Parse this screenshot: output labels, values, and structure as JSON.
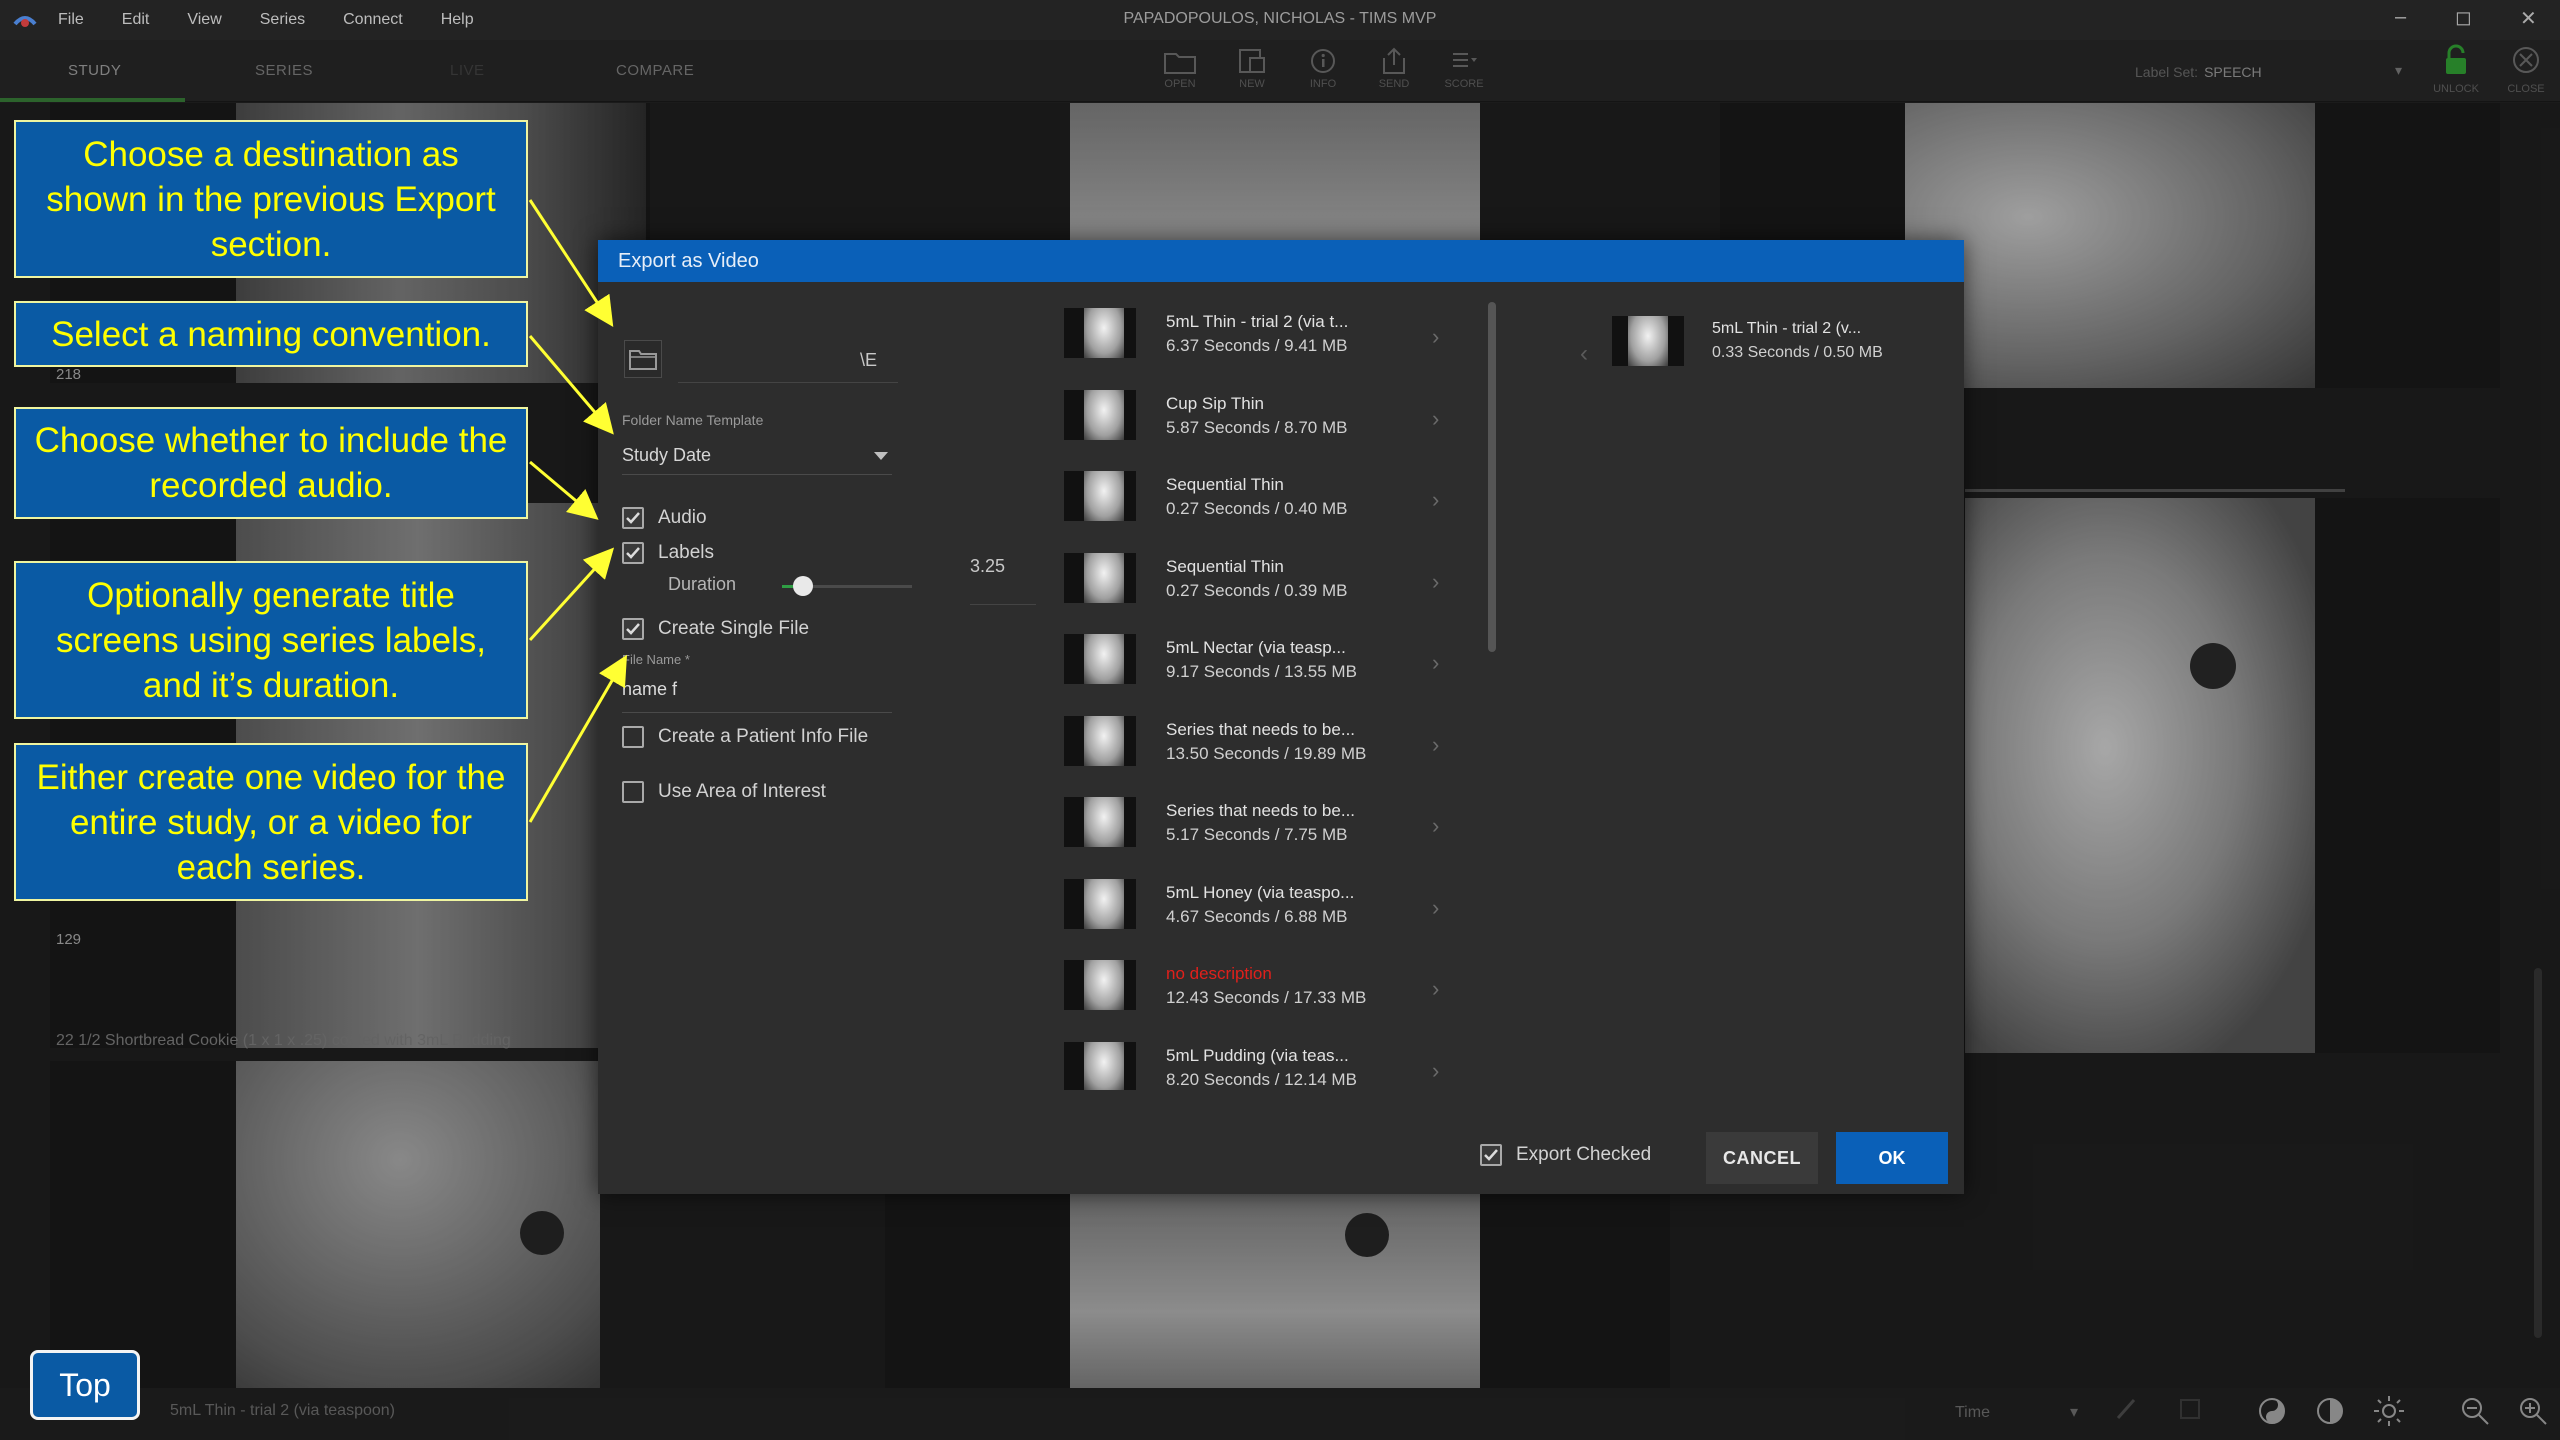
{
  "window": {
    "title": "PAPADOPOULOS, NICHOLAS - TIMS MVP",
    "menu": [
      "File",
      "Edit",
      "View",
      "Series",
      "Connect",
      "Help"
    ]
  },
  "tabs": [
    "STUDY",
    "SERIES",
    "LIVE",
    "COMPARE"
  ],
  "toolbar": {
    "tools": [
      "OPEN",
      "NEW",
      "INFO",
      "SEND",
      "SCORE"
    ],
    "label_set_prefix": "Label Set:",
    "label_set_value": "SPEECH",
    "unlock_label": "UNLOCK",
    "close_label": "CLOSE"
  },
  "workspace": {
    "frame_numbers": [
      "218",
      "129"
    ],
    "series_caption": "22  1/2 Shortbread Cookie (1 x 1 x .25) coated with 3mL Pudding"
  },
  "bottom": {
    "caption": "5mL Thin - trial 2 (via teaspoon)",
    "time_label": "Time"
  },
  "dialog": {
    "title": "Export as Video",
    "destination_path": "\\E",
    "folder_template_label": "Folder Name Template",
    "folder_template_value": "Study Date",
    "audio_label": "Audio",
    "audio_checked": true,
    "labels_label": "Labels",
    "labels_checked": true,
    "duration_label": "Duration",
    "duration_value": "3.25",
    "duration_fraction": 0.16,
    "single_file_label": "Create Single File",
    "single_file_checked": true,
    "file_name_label": "File Name *",
    "file_name_value": "name f",
    "patient_info_label": "Create a Patient Info File",
    "patient_info_checked": false,
    "area_of_interest_label": "Use Area of Interest",
    "area_of_interest_checked": false,
    "series": [
      {
        "title": "5mL Thin - trial 2 (via t...",
        "meta": "6.37 Seconds / 9.41 MB",
        "red": false
      },
      {
        "title": "Cup Sip Thin",
        "meta": "5.87 Seconds / 8.70 MB",
        "red": false
      },
      {
        "title": "Sequential Thin",
        "meta": "0.27 Seconds / 0.40 MB",
        "red": false
      },
      {
        "title": "Sequential Thin",
        "meta": "0.27 Seconds / 0.39 MB",
        "red": false
      },
      {
        "title": "5mL Nectar (via teasp...",
        "meta": "9.17 Seconds / 13.55 MB",
        "red": false
      },
      {
        "title": "Series that needs to be...",
        "meta": "13.50 Seconds / 19.89 MB",
        "red": false
      },
      {
        "title": "Series that needs to be...",
        "meta": "5.17 Seconds / 7.75 MB",
        "red": false
      },
      {
        "title": "5mL Honey (via teaspo...",
        "meta": "4.67 Seconds / 6.88 MB",
        "red": false
      },
      {
        "title": "no description",
        "meta": "12.43 Seconds / 17.33 MB",
        "red": true
      },
      {
        "title": "5mL Pudding (via teas...",
        "meta": "8.20 Seconds / 12.14 MB",
        "red": false
      }
    ],
    "selected": {
      "title": "5mL Thin - trial 2 (v...",
      "meta": "0.33 Seconds / 0.50 MB"
    },
    "export_checked_label": "Export Checked",
    "export_checked": true,
    "cancel_label": "CANCEL",
    "ok_label": "OK"
  },
  "callouts": [
    "Choose a destination as shown in the previous Export section.",
    "Select a naming convention.",
    "Choose whether to include the recorded audio.",
    "Optionally generate title screens using series labels, and it’s duration.",
    "Either create one video for the entire study, or a video for each series."
  ],
  "top_button": "Top",
  "colors": {
    "dialog_header": "#0a60b8",
    "callout_bg": "#0a5aa4",
    "callout_text": "#ffff00",
    "arrow": "#ffff33",
    "slider_fill": "#2f9e44",
    "error_text": "#e0201b"
  }
}
